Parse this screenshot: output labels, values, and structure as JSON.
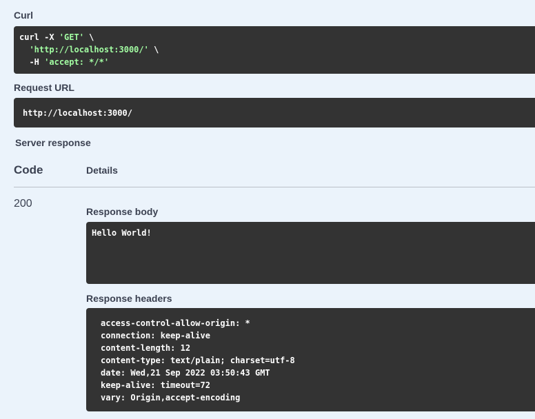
{
  "curl": {
    "label": "Curl",
    "line1_cmd": "curl -X ",
    "line1_method": "'GET'",
    "line1_tail": " \\",
    "line2_url": "'http://localhost:3000/'",
    "line2_tail": " \\",
    "line3_flag": "-H ",
    "line3_header": "'accept: */*'"
  },
  "request_url": {
    "label": "Request URL",
    "value": "http://localhost:3000/"
  },
  "server_response": {
    "label": "Server response",
    "code_header": "Code",
    "details_header": "Details",
    "code": "200",
    "body_label": "Response body",
    "body": "Hello World!",
    "headers_label": "Response headers",
    "headers": [
      "access-control-allow-origin: *",
      "connection: keep-alive",
      "content-length: 12",
      "content-type: text/plain; charset=utf-8",
      "date: Wed,21 Sep 2022 03:50:43 GMT",
      "keep-alive: timeout=72",
      "vary: Origin,accept-encoding"
    ]
  },
  "colors": {
    "background": "#ebf3fb",
    "code_bg": "#333333",
    "string": "#a2fca2"
  }
}
